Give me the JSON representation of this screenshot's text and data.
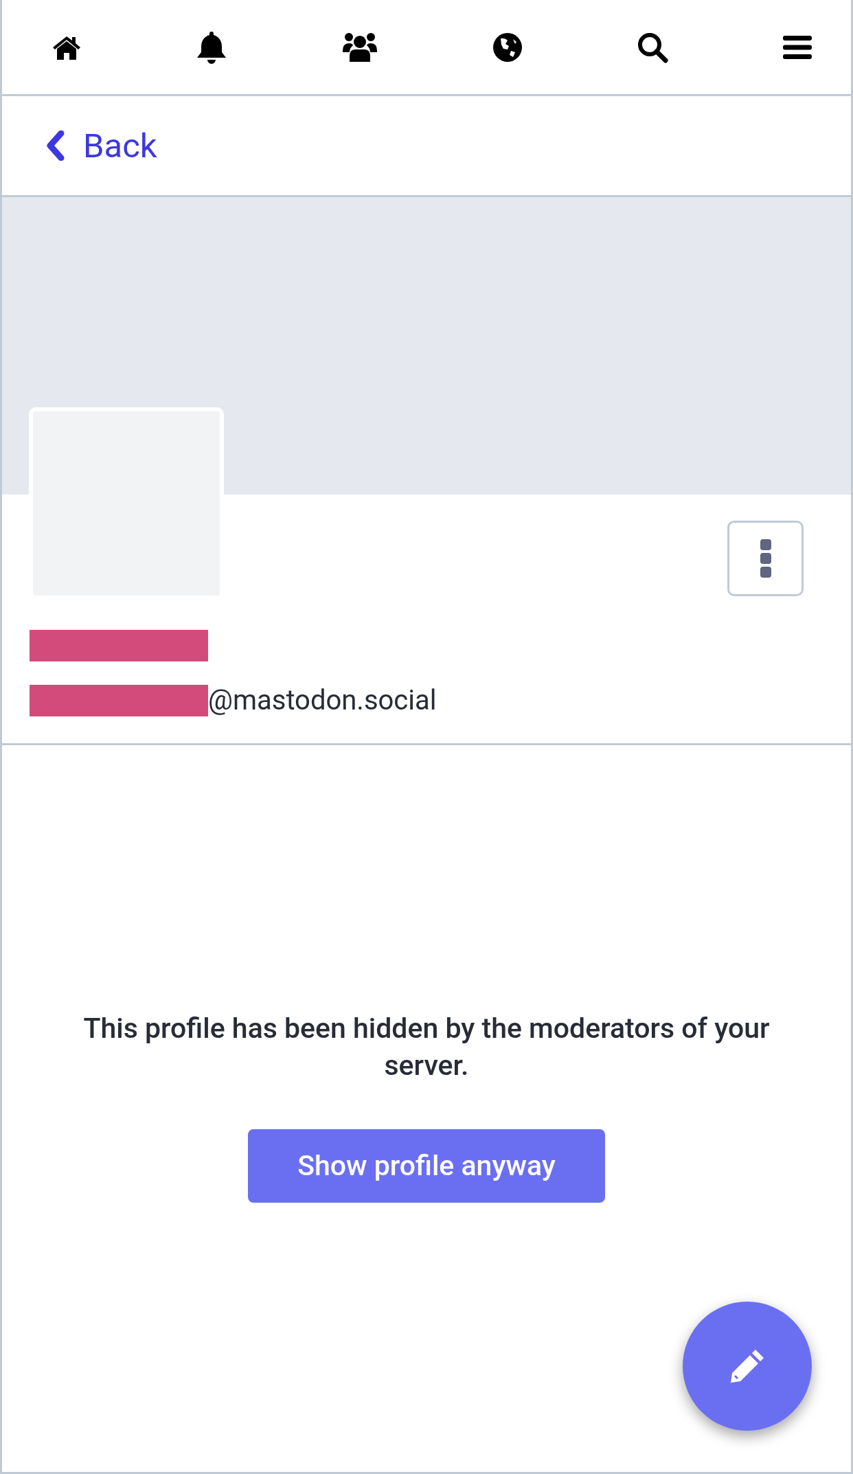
{
  "nav_icons": [
    {
      "kind": "home"
    },
    {
      "kind": "bell"
    },
    {
      "kind": "people"
    },
    {
      "kind": "globe"
    },
    {
      "kind": "search"
    },
    {
      "kind": "menu"
    }
  ],
  "back_link": {
    "label": "Back"
  },
  "profile": {
    "name_redacted": true,
    "handle_redacted": true,
    "handle_domain": "@mastodon.social"
  },
  "notice": {
    "message": "This profile has been hidden by the moderators of your server.",
    "button": "Show profile anyway"
  },
  "compose_button": {
    "kind": "pencil"
  }
}
